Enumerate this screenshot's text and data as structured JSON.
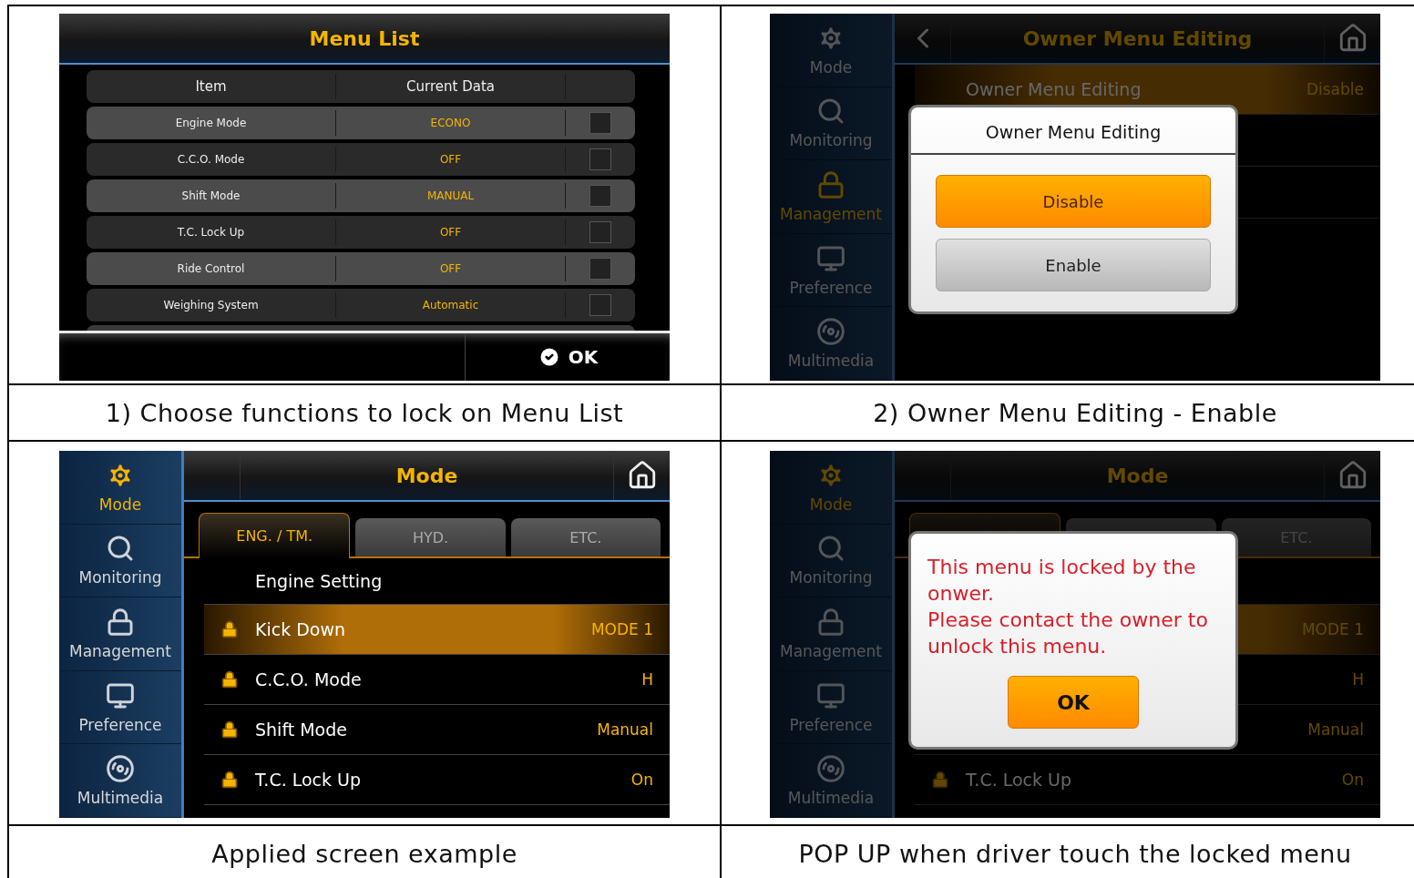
{
  "cells": [
    {
      "kind": "menu_list",
      "caption": "1) Choose functions to lock on Menu List",
      "screen": {
        "title": "Menu List",
        "columns": [
          "Item",
          "Current Data"
        ],
        "rows": [
          {
            "item": "Engine Mode",
            "value": "ECONO",
            "checked": false
          },
          {
            "item": "C.C.O. Mode",
            "value": "OFF",
            "checked": false
          },
          {
            "item": "Shift Mode",
            "value": "MANUAL",
            "checked": false
          },
          {
            "item": "T.C. Lock Up",
            "value": "OFF",
            "checked": false
          },
          {
            "item": "Ride Control",
            "value": "OFF",
            "checked": false
          },
          {
            "item": "Weighing System",
            "value": "Automatic",
            "checked": false
          }
        ],
        "ok": "OK"
      }
    },
    {
      "kind": "app",
      "caption": "2) Owner Menu Editing - Enable",
      "screen": {
        "dimmed": true,
        "sidebar": [
          {
            "label": "Mode",
            "selected": false
          },
          {
            "label": "Monitoring",
            "selected": false
          },
          {
            "label": "Management",
            "selected": true
          },
          {
            "label": "Preference",
            "selected": false
          },
          {
            "label": "Multimedia",
            "selected": false
          }
        ],
        "header": {
          "title": "Owner Menu Editing",
          "back": true
        },
        "rows": [
          {
            "label": "Owner Menu Editing",
            "value": "Disable",
            "locked": false,
            "selected": true
          },
          {
            "kind": "empty"
          },
          {
            "kind": "empty"
          }
        ],
        "dialog": {
          "kind": "choice",
          "title": "Owner Menu Editing",
          "buttons": [
            {
              "label": "Disable",
              "selected": true
            },
            {
              "label": "Enable",
              "selected": false
            }
          ]
        }
      }
    },
    {
      "kind": "app",
      "caption": "Applied screen example",
      "screen": {
        "dimmed": false,
        "sidebar": [
          {
            "label": "Mode",
            "selected": true
          },
          {
            "label": "Monitoring",
            "selected": false
          },
          {
            "label": "Management",
            "selected": false
          },
          {
            "label": "Preference",
            "selected": false
          },
          {
            "label": "Multimedia",
            "selected": false
          }
        ],
        "header": {
          "title": "Mode",
          "back": false
        },
        "tabs": [
          {
            "label": "ENG. / TM.",
            "selected": true
          },
          {
            "label": "HYD.",
            "selected": false
          },
          {
            "label": "ETC.",
            "selected": false
          }
        ],
        "rows": [
          {
            "kind": "heading",
            "label": "Engine Setting"
          },
          {
            "label": "Kick Down",
            "value": "MODE 1",
            "locked": true,
            "selected": true
          },
          {
            "label": "C.C.O. Mode",
            "value": "H",
            "locked": true,
            "selected": false
          },
          {
            "label": "Shift Mode",
            "value": "Manual",
            "locked": true,
            "selected": false
          },
          {
            "label": "T.C. Lock Up",
            "value": "On",
            "locked": true,
            "selected": false
          }
        ]
      }
    },
    {
      "kind": "app",
      "caption": "POP UP when driver touch the locked menu",
      "screen": {
        "dimmed": true,
        "sidebar": [
          {
            "label": "Mode",
            "selected": true
          },
          {
            "label": "Monitoring",
            "selected": false
          },
          {
            "label": "Management",
            "selected": false
          },
          {
            "label": "Preference",
            "selected": false
          },
          {
            "label": "Multimedia",
            "selected": false
          }
        ],
        "header": {
          "title": "Mode",
          "back": false
        },
        "tabs": [
          {
            "selected": true
          },
          {
            "selected": false
          },
          {
            "label": "ETC.",
            "selected": false
          }
        ],
        "rows": [
          {
            "kind": "heading"
          },
          {
            "value": "MODE 1",
            "locked": false,
            "selected": true
          },
          {
            "value": "H",
            "locked": false,
            "selected": false
          },
          {
            "value": "Manual",
            "locked": false,
            "selected": false
          },
          {
            "label": "T.C. Lock Up",
            "value": "On",
            "locked": true,
            "selected": false
          }
        ],
        "dialog": {
          "kind": "message",
          "lines": [
            "This menu is locked by the onwer.",
            "Please contact the owner to unlock this menu."
          ],
          "button": "OK"
        }
      }
    }
  ]
}
